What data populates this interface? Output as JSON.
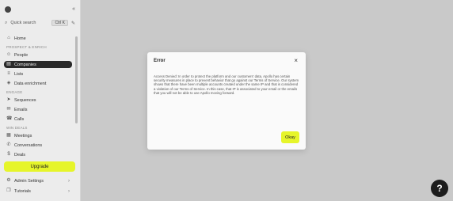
{
  "sidebar": {
    "quick_search": "Quick search",
    "shortcut": "Ctrl K",
    "section_prospect": "Prospect & enrich",
    "section_engage": "Engage",
    "section_win": "Win deals",
    "items": [
      {
        "label": "Home",
        "icon": "home-icon"
      },
      {
        "label": "People",
        "icon": "people-icon"
      },
      {
        "label": "Companies",
        "icon": "building-icon"
      },
      {
        "label": "Lists",
        "icon": "list-icon"
      },
      {
        "label": "Data enrichment",
        "icon": "enrich-icon"
      },
      {
        "label": "Sequences",
        "icon": "send-icon"
      },
      {
        "label": "Emails",
        "icon": "mail-icon"
      },
      {
        "label": "Calls",
        "icon": "phone-icon"
      },
      {
        "label": "Meetings",
        "icon": "calendar-icon"
      },
      {
        "label": "Conversations",
        "icon": "chat-icon"
      },
      {
        "label": "Deals",
        "icon": "dollar-icon"
      },
      {
        "label": "Admin Settings",
        "icon": "gear-icon"
      },
      {
        "label": "Tutorials",
        "icon": "book-icon"
      }
    ],
    "upgrade_label": "Upgrade"
  },
  "modal": {
    "title": "Error",
    "close_glyph": "×",
    "body": "Access Denied: In order to protect the platform and our customers' data, Apollo has certain security measures in place to prevent behavior that go against our Terms of Service. Our system shows that there have been multiple accounts created under the same IP and that is considered a violation of our Terms of Service. In this case, that IP is associated to your email or the emails that you will not be able to use Apollo moving forward.",
    "ok_label": "Okay"
  },
  "help": {
    "label": "?"
  },
  "colors": {
    "accent": "#e6f52a",
    "active_nav": "#2a2a2a",
    "backdrop": "#c9c9c9"
  }
}
